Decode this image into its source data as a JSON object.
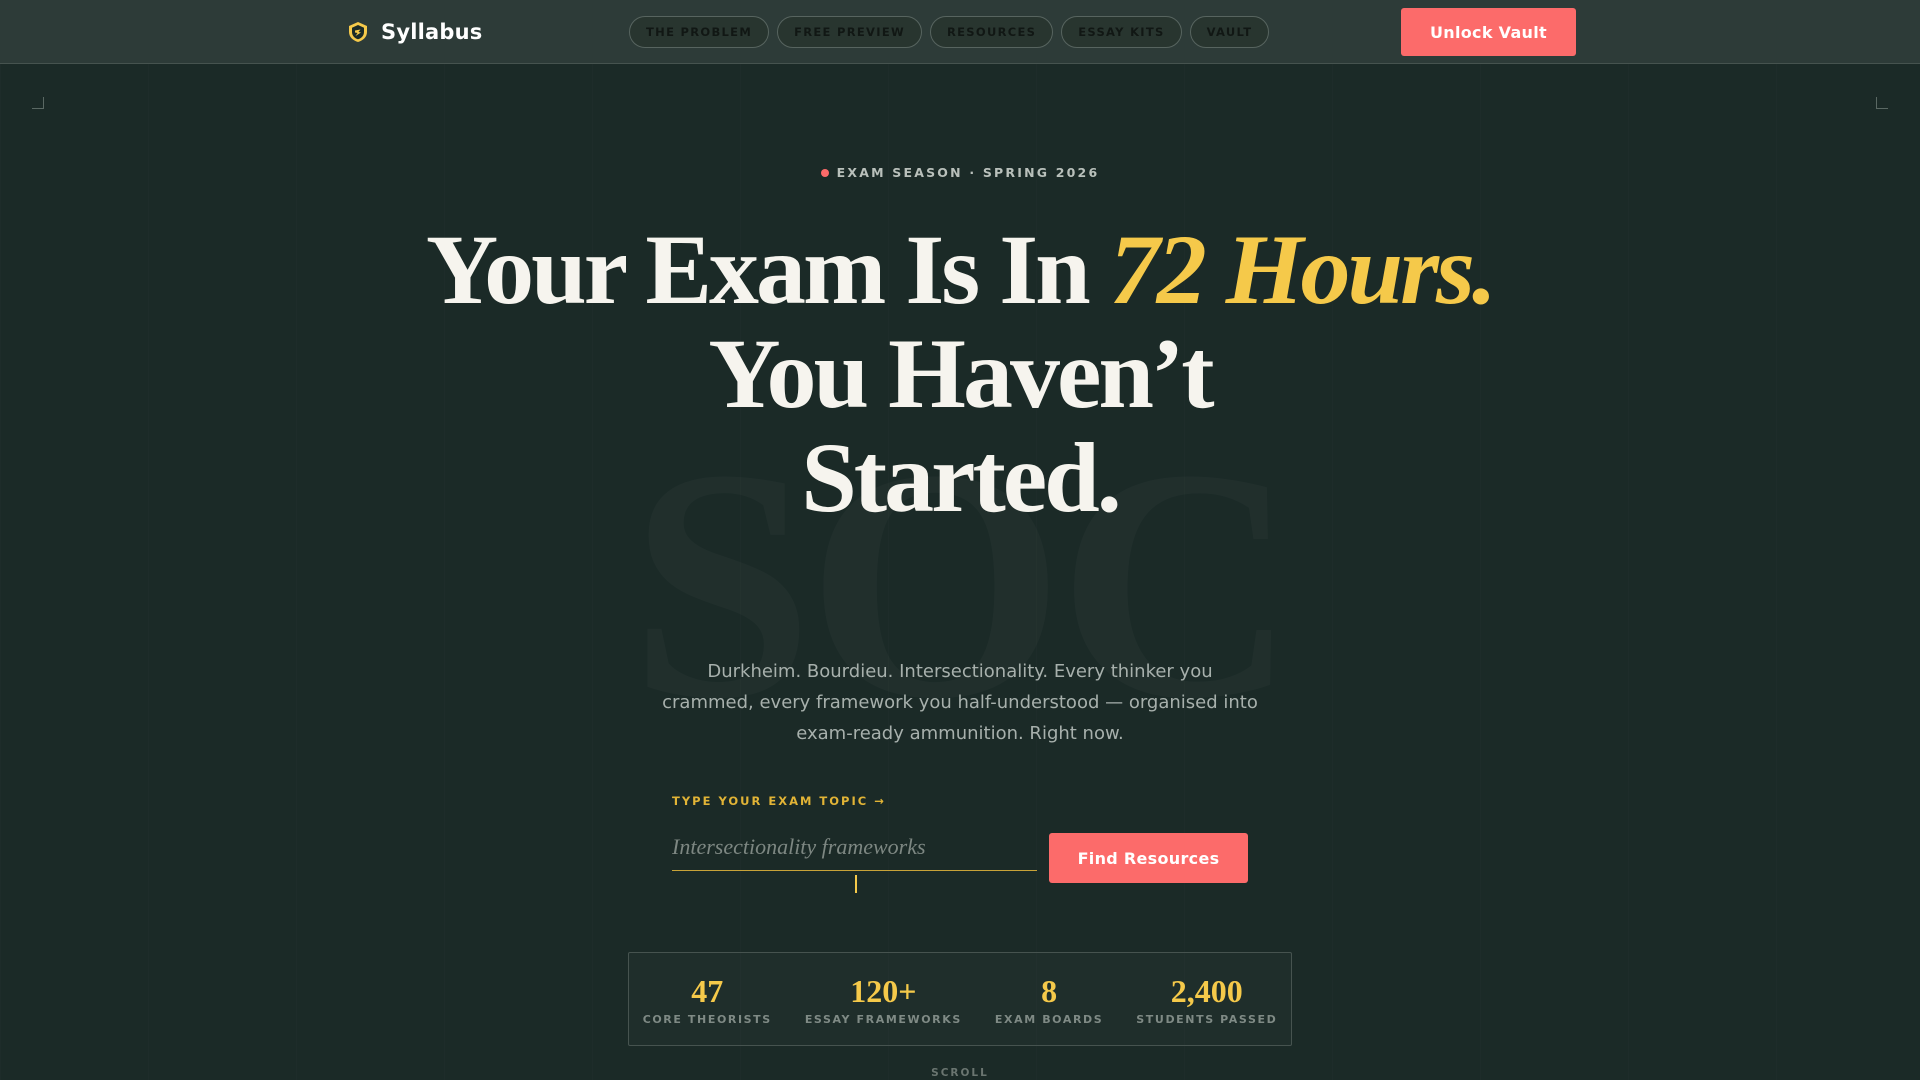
{
  "nav": {
    "brand": "Syllabus",
    "links": [
      "THE PROBLEM",
      "FREE PREVIEW",
      "RESOURCES",
      "ESSAY KITS",
      "VAULT"
    ],
    "cta": "Unlock Vault"
  },
  "hero": {
    "eyebrow": "EXAM SEASON · SPRING 2026",
    "watermark": "SOC",
    "headline": {
      "part1": "Your Exam Is In ",
      "accent": "72 Hours.",
      "line3": "You Haven’t",
      "line4": "Started."
    },
    "subtitle": "Durkheim. Bourdieu. Intersectionality. Every thinker you crammed, every framework you half-understood — organised into exam-ready ammunition. Right now."
  },
  "search": {
    "label": "TYPE YOUR EXAM TOPIC →",
    "placeholder": "Intersectionality frameworks",
    "button": "Find Resources"
  },
  "stats": [
    {
      "value": "47",
      "label": "CORE THEORISTS"
    },
    {
      "value": "120+",
      "label": "ESSAY FRAMEWORKS"
    },
    {
      "value": "8",
      "label": "EXAM BOARDS"
    },
    {
      "value": "2,400",
      "label": "STUDENTS PASSED"
    }
  ],
  "scroll_label": "SCROLL",
  "colors": {
    "background": "#1b2a27",
    "nav": "#2d3b38",
    "accent_gold": "#f5c94a",
    "accent_coral": "#fc6b6a"
  },
  "icons": {
    "brand": "shield-logo-icon"
  }
}
